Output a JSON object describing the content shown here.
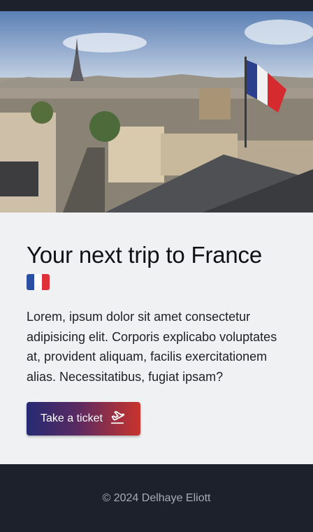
{
  "hero": {
    "image_alt": "Paris skyline with the Eiffel Tower and a French flag"
  },
  "main": {
    "title": "Your next trip to France",
    "flag_emoji": "french-flag-icon",
    "description": "Lorem, ipsum dolor sit amet consectetur adipisicing elit. Corporis explicabo voluptates at, provident aliquam, facilis exercitationem alias. Necessitatibus, fugiat ipsam?",
    "cta_label": "Take a ticket",
    "cta_icon": "plane-departure-icon"
  },
  "footer": {
    "copyright": "© 2024 Delhaye Eliott"
  },
  "colors": {
    "page_dark": "#1c212b",
    "content_bg": "#f0f1f3",
    "cta_gradient_start": "#262a73",
    "cta_gradient_end": "#c8342c",
    "flag_blue": "#2a4fa3",
    "flag_white": "#ffffff",
    "flag_red": "#e0313b"
  }
}
